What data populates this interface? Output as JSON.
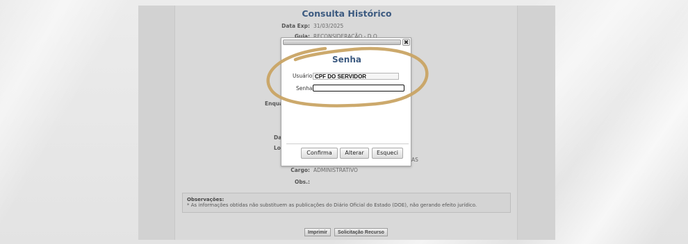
{
  "page": {
    "title": "Consulta Histórico",
    "fields": [
      {
        "label": "Data Exp:",
        "value": "31/03/2025"
      },
      {
        "label": "Guia:",
        "value": "RECONSIDERAÇÃO - D.O."
      },
      {
        "label": "Cargo:",
        "value": "ADMINISTRATIVO"
      },
      {
        "label": "Obs.:",
        "value": ""
      }
    ],
    "partial_labels": [
      "Enqua",
      "Da",
      "Lo"
    ],
    "partial_value": "AS",
    "observations_title": "Observações:",
    "observations_text": "* As informações obtidas não substituem as publicações do Diário Oficial do Estado (DOE), não gerando efeito jurídico.",
    "buttons": {
      "print": "Imprimir",
      "appeal": "Solicitação Recurso"
    }
  },
  "modal": {
    "title": "Senha",
    "close_glyph": "✖",
    "user_label": "Usuário",
    "user_value": "CPF DO SERVIDOR",
    "password_label": "Senha",
    "password_value": "",
    "buttons": {
      "confirm": "Confirma",
      "change": "Alterar",
      "forgot": "Esqueci"
    }
  },
  "colors": {
    "accent": "#3c5a80",
    "annotation": "#c9a464"
  }
}
